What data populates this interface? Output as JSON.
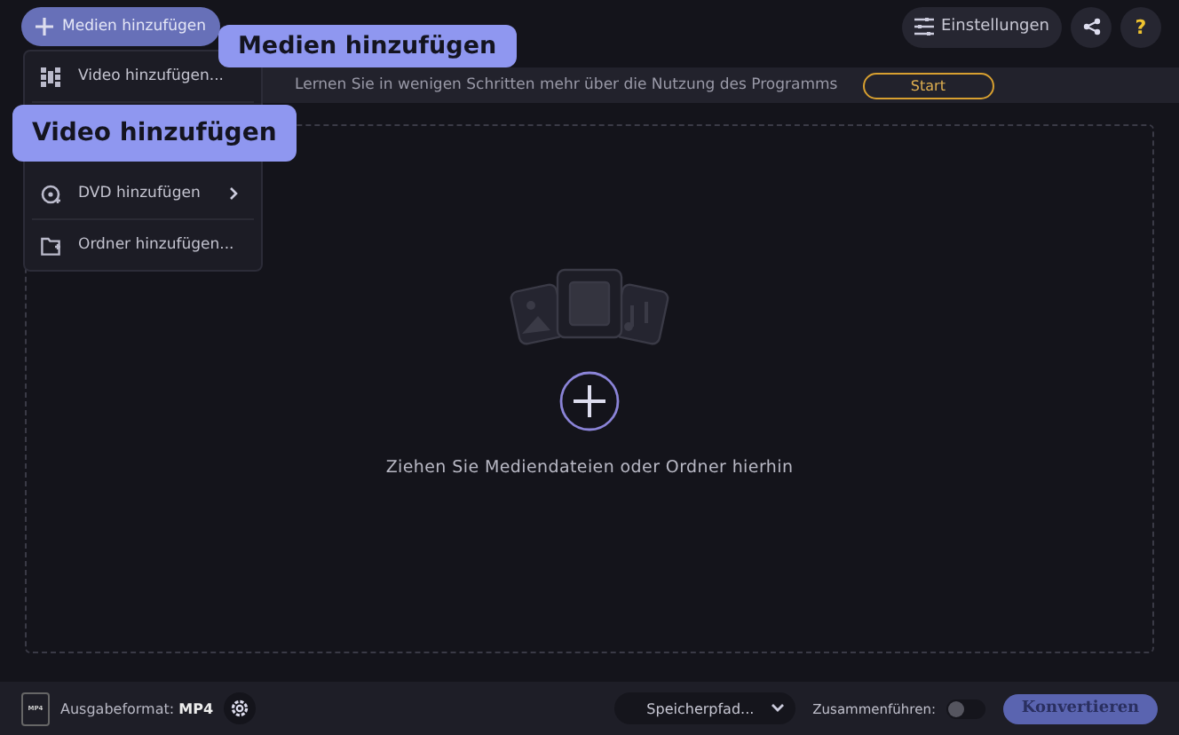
{
  "toolbar": {
    "add_media_button": "Medien hinzufügen",
    "settings_button": "Einstellungen",
    "help_button": "?"
  },
  "hint_bar": {
    "text": "Lernen Sie in wenigen Schritten mehr über die Nutzung des Programms",
    "start_button": "Start"
  },
  "add_menu": [
    {
      "kind": "video",
      "label": "Video hinzufügen...",
      "submenu": false
    },
    {
      "kind": "dvd",
      "label": "DVD hinzufügen",
      "submenu": true
    },
    {
      "kind": "folder",
      "label": "Ordner hinzufügen...",
      "submenu": false
    }
  ],
  "tooltips": [
    {
      "kind": "media",
      "text": "Medien hinzufügen"
    },
    {
      "kind": "video",
      "text": "Video hinzufügen"
    }
  ],
  "drop_zone": {
    "text": "Ziehen Sie Mediendateien oder Ordner hierhin"
  },
  "bottom_bar": {
    "format_label": "Ausgabeformat:",
    "format_value": "MP4",
    "format_icon_text": "MP4",
    "save_path": "Speicherpfad...",
    "merge_label": "Zusammenführen:",
    "merge_on": false,
    "convert_button": "Konvertieren"
  }
}
